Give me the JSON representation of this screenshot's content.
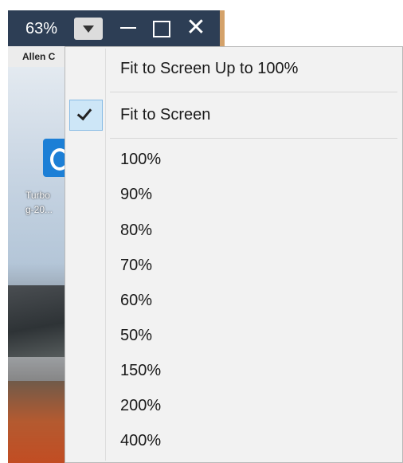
{
  "titlebar": {
    "zoom_value": "63%",
    "dropdown_icon": "chevron-down-icon",
    "minimize_icon": "minimize-icon",
    "maximize_icon": "maximize-icon",
    "close_icon": "close-icon"
  },
  "desktop": {
    "user_label": "Allen C",
    "icon_label_1": "Turbo",
    "icon_label_2": "g-20..."
  },
  "menu": {
    "items": [
      {
        "label": "Fit to Screen Up to 100%",
        "checked": false
      },
      {
        "label": "Fit to Screen",
        "checked": true
      },
      {
        "label": "100%",
        "checked": false
      },
      {
        "label": "90%",
        "checked": false
      },
      {
        "label": "80%",
        "checked": false
      },
      {
        "label": "70%",
        "checked": false
      },
      {
        "label": "60%",
        "checked": false
      },
      {
        "label": "50%",
        "checked": false
      },
      {
        "label": "150%",
        "checked": false
      },
      {
        "label": "200%",
        "checked": false
      },
      {
        "label": "400%",
        "checked": false
      }
    ]
  }
}
